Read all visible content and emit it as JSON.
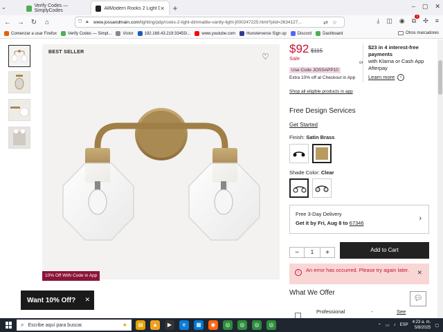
{
  "browser": {
    "tabs": [
      {
        "title": "Verify Codes — SimplyCodes",
        "active": false,
        "favicon_color": "#4caf50"
      },
      {
        "title": "AllModern Rooks 2 Light Dimm",
        "active": true,
        "favicon_color": "#222222"
      }
    ],
    "new_tab": "+",
    "url_host": "www.jossandmain.com",
    "url_path": "/lighting/pdp/rooks-2-light-dimmable-vanity-light-j000247225.html?piid=2634127..."
  },
  "bookmarks": [
    {
      "label": "Comenzar a usar Firefox",
      "color": "#e66000"
    },
    {
      "label": "Verify Codes — Simpl...",
      "color": "#4caf50"
    },
    {
      "label": "Victor",
      "color": "#888888"
    },
    {
      "label": "192.168.43.219:33455/...",
      "color": "#1e5bb8"
    },
    {
      "label": "www.youtube.com",
      "color": "#ff0000"
    },
    {
      "label": "Hunsterverse Sign up",
      "color": "#2f3a8f"
    },
    {
      "label": "Discord",
      "color": "#5865f2"
    },
    {
      "label": "Dashboard",
      "color": "#4caf50"
    }
  ],
  "bookmarks_right": "Otros marcadores",
  "product": {
    "badge": "BEST SELLER",
    "promo_tag": "10% Off With Code in App",
    "price": "$92",
    "old_price": "$115",
    "sale": "Sale",
    "or": "or",
    "klarna_bold": "$23 in 4 interest-free payments",
    "klarna_rest": "with Klarna or Cash App Afterpay",
    "learn_more": "Learn more",
    "use_code": "Use Code JOSSAPP10",
    "extra": "Extra 10% off at Checkout in App",
    "shop_all": "Shop all eligible products in app",
    "free_design": "Free Design Services",
    "get_started": "Get Started",
    "finish_label": "Finish:",
    "finish_value": "Satin Brass",
    "shade_label": "Shade Color:",
    "shade_value": "Clear",
    "delivery_title": "Free 3-Day Delivery",
    "delivery_when": "Get it by Fri, Aug 8 to",
    "delivery_zip": "67346",
    "qty": "1",
    "add_to_cart": "Add to Cart",
    "error": "An error has occurred. Please try again later.",
    "what_we_offer": "What We Offer",
    "professional": "Professional",
    "prof_dash": "-",
    "prof_see": "See",
    "want_10": "Want 10% Off?"
  },
  "taskbar": {
    "search_placeholder": "Escribe aquí para buscar.",
    "lang": "ESP",
    "time": "4:23 a. m.",
    "date": "5/8/2025"
  },
  "colors": {
    "sale_red": "#c8102e",
    "brass": "#a88a52",
    "promo_maroon": "#8a1538"
  }
}
